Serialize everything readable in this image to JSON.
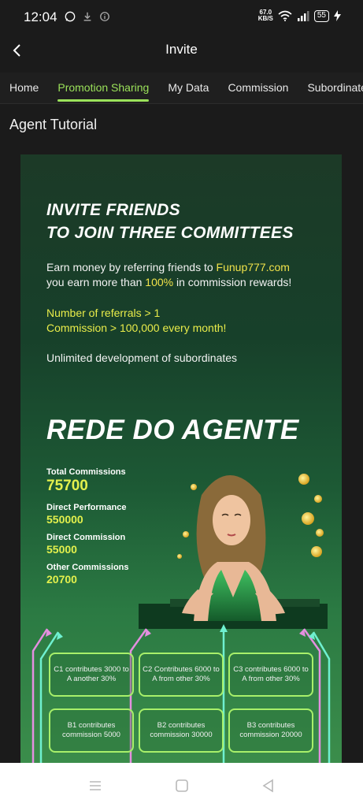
{
  "status_bar": {
    "time": "12:04",
    "net_speed_value": "67.0",
    "net_speed_unit": "KB/S",
    "battery": "55",
    "icons": [
      "whatsapp-icon",
      "download-icon",
      "info-icon",
      "wifi-icon",
      "signal-icon",
      "battery-icon",
      "charging-icon"
    ]
  },
  "header": {
    "title": "Invite",
    "back_icon": "chevron-left-icon"
  },
  "tabs": [
    {
      "label": "Home",
      "active": false
    },
    {
      "label": "Promotion Sharing",
      "active": true
    },
    {
      "label": "My Data",
      "active": false
    },
    {
      "label": "Commission",
      "active": false
    },
    {
      "label": "Subordinate",
      "active": false
    }
  ],
  "section_title": "Agent Tutorial",
  "poster": {
    "heading_line1": "INVITE FRIENDS",
    "heading_line2": "TO JOIN THREE COMMITTEES",
    "intro_a": "Earn money by referring friends to ",
    "intro_site": "Funup777.com",
    "intro_b": "you earn more than ",
    "intro_pct": "100%",
    "intro_c": " in commission rewards!",
    "referral_line1": "Number of referrals > 1",
    "referral_line2": "Commission > 100,000 every month!",
    "unlimited": "Unlimited development of subordinates",
    "rede": "REDE DO AGENTE",
    "stats": [
      {
        "label": "Total Commissions",
        "value": "75700"
      },
      {
        "label": "Direct Performance",
        "value": "550000"
      },
      {
        "label": "Direct Commission",
        "value": "55000"
      },
      {
        "label": "Other Commissions",
        "value": "20700"
      }
    ],
    "contrib_boxes": [
      {
        "text": "C1 contributes 3000 to A another 30%"
      },
      {
        "text": "C2 Contributes 6000 to A from other 30%"
      },
      {
        "text": "C3 contributes 6000 to A from other 30%"
      }
    ],
    "commission_boxes": [
      {
        "text": "B1 contributes commission 5000"
      },
      {
        "text": "B2 contributes commission 30000"
      },
      {
        "text": "B3 contributes commission 20000"
      }
    ],
    "colors": {
      "accent_green": "#9be25a",
      "highlight_yellow": "#e3f04d",
      "arrow_cyan": "#6ff0d0",
      "arrow_pink": "#e48fe0"
    }
  },
  "nav_bar": {
    "icons": [
      "menu-icon",
      "home-square-icon",
      "back-triangle-icon"
    ]
  }
}
